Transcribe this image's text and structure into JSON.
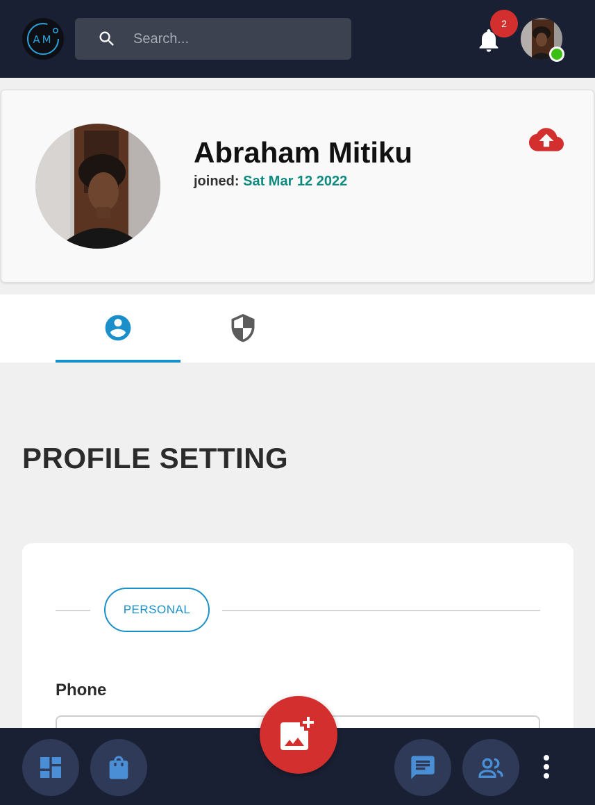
{
  "header": {
    "logo_text": "AM",
    "search": {
      "placeholder": "Search...",
      "value": ""
    },
    "notifications": {
      "count": "2"
    },
    "user_status": "online"
  },
  "profile": {
    "name": "Abraham Mitiku",
    "joined_label": "joined:",
    "joined_date": "Sat Mar 12 2022"
  },
  "tabs": [
    {
      "icon": "account-circle-icon",
      "active": true
    },
    {
      "icon": "shield-icon",
      "active": false
    }
  ],
  "section": {
    "title": "PROFILE SETTING"
  },
  "form": {
    "chip_label": "PERSONAL",
    "phone": {
      "label": "Phone",
      "value": ""
    }
  },
  "bottom_nav": {
    "items": [
      "dashboard-icon",
      "shopping-bag-icon",
      "chat-icon",
      "people-icon",
      "more-vert-icon"
    ],
    "fab_icon": "add-photo-icon"
  },
  "colors": {
    "topbar_bg": "#1a2033",
    "accent": "#1a8fc9",
    "danger": "#d32f2f",
    "joined_date": "#0e8a7e",
    "online": "#3bbf14",
    "nav_button_bg": "#2e3a57",
    "nav_icon": "#4a8fd6"
  }
}
